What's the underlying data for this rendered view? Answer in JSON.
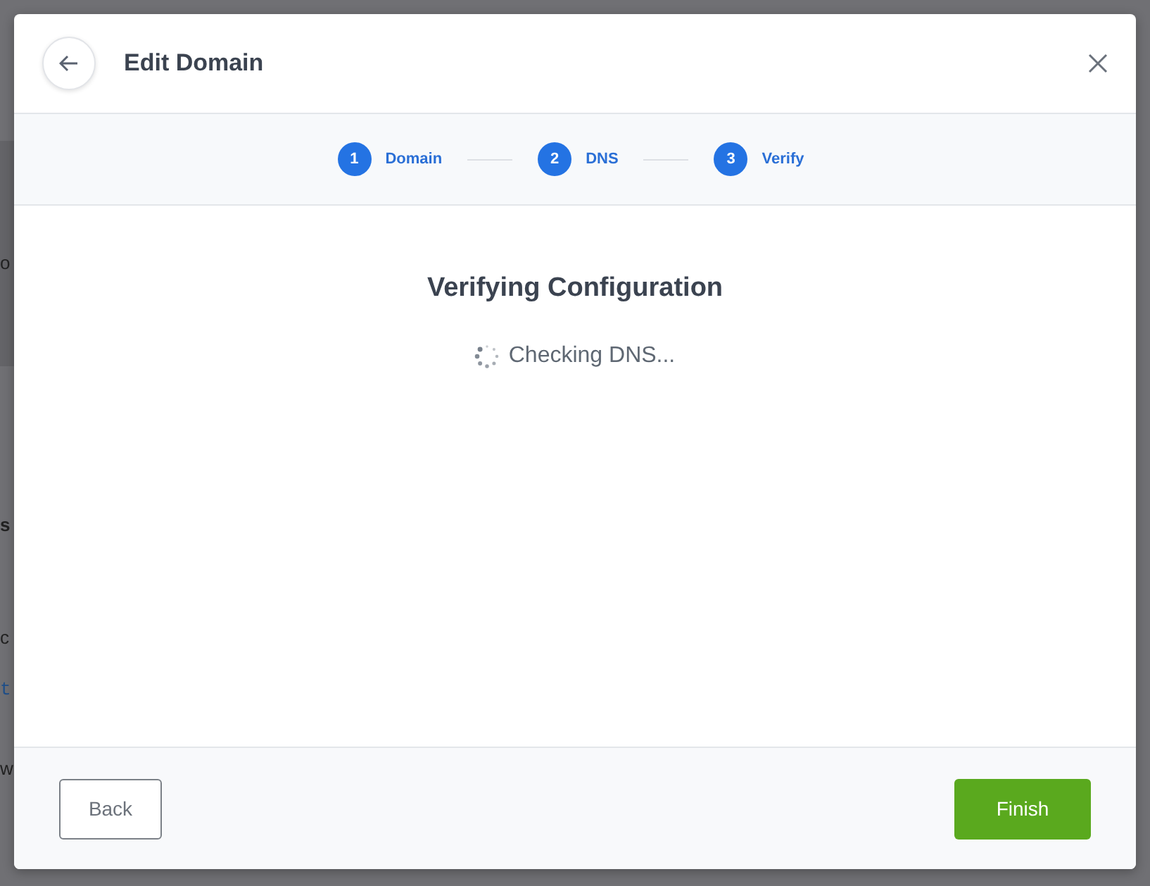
{
  "background_page": {
    "fragments": [
      {
        "text": "o",
        "kind": "plain"
      },
      {
        "text": "s",
        "kind": "bold"
      },
      {
        "text": "c",
        "kind": "plain"
      },
      {
        "text": "t",
        "kind": "link"
      },
      {
        "text": "w",
        "kind": "plain"
      }
    ]
  },
  "dialog": {
    "title": "Edit Domain",
    "steps": [
      {
        "number": "1",
        "label": "Domain",
        "selected": true
      },
      {
        "number": "2",
        "label": "DNS",
        "selected": true
      },
      {
        "number": "3",
        "label": "Verify",
        "selected": true
      }
    ],
    "heading": "Verifying Configuration",
    "status": "Checking DNS...",
    "buttons": [
      {
        "label": "Back",
        "kind": "secondary"
      },
      {
        "label": "Finish",
        "kind": "primary"
      }
    ]
  }
}
